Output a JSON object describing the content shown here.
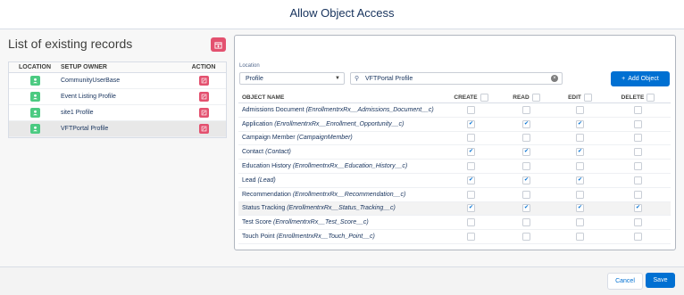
{
  "modal": {
    "title": "Allow Object Access"
  },
  "left": {
    "title": "List of existing records",
    "columns": {
      "location": "LOCATION",
      "owner": "SETUP OWNER",
      "action": "ACTION"
    },
    "records": [
      {
        "owner": "CommunityUserBase"
      },
      {
        "owner": "Event Listing Profile"
      },
      {
        "owner": "site1 Profile"
      },
      {
        "owner": "VFTPortal Profile"
      }
    ]
  },
  "right": {
    "location_label": "Location",
    "location_value": "Profile",
    "search_value": "VFTPortal Profile",
    "add_object_label": "Add Object",
    "columns": {
      "object": "OBJECT NAME",
      "create": "CREATE",
      "read": "READ",
      "edit": "EDIT",
      "delete": "DELETE"
    },
    "rows": [
      {
        "name": "Admissions Document",
        "api": "(EnrollmentrxRx__Admissions_Document__c)",
        "c": "",
        "r": "",
        "e": "",
        "d": ""
      },
      {
        "name": "Application",
        "api": "(EnrollmentrxRx__Enrollment_Opportunity__c)",
        "c": "✔",
        "r": "✔",
        "e": "✔",
        "d": ""
      },
      {
        "name": "Campaign Member",
        "api": "(CampaignMember)",
        "c": "",
        "r": "",
        "e": "",
        "d": ""
      },
      {
        "name": "Contact",
        "api": "(Contact)",
        "c": "✔",
        "r": "✔",
        "e": "✔",
        "d": ""
      },
      {
        "name": "Education History",
        "api": "(EnrollmentrxRx__Education_History__c)",
        "c": "",
        "r": "",
        "e": "",
        "d": ""
      },
      {
        "name": "Lead",
        "api": "(Lead)",
        "c": "✔",
        "r": "✔",
        "e": "✔",
        "d": ""
      },
      {
        "name": "Recommendation",
        "api": "(EnrollmentrxRx__Recommendation__c)",
        "c": "",
        "r": "",
        "e": "",
        "d": ""
      },
      {
        "name": "Status Tracking",
        "api": "(EnrollmentrxRx__Status_Tracking__c)",
        "c": "✔",
        "r": "✔",
        "e": "✔",
        "d": "✔"
      },
      {
        "name": "Test Score",
        "api": "(EnrollmentrxRx__Test_Score__c)",
        "c": "",
        "r": "",
        "e": "",
        "d": ""
      },
      {
        "name": "Touch Point",
        "api": "(EnrollmentrxRx__Touch_Point__c)",
        "c": "",
        "r": "",
        "e": "",
        "d": ""
      }
    ]
  },
  "footer": {
    "cancel_label": "Cancel",
    "save_label": "Save"
  },
  "colors": {
    "brand": "#0070d2",
    "location_icon": "#4bca81",
    "action_icon": "#e3516f"
  }
}
